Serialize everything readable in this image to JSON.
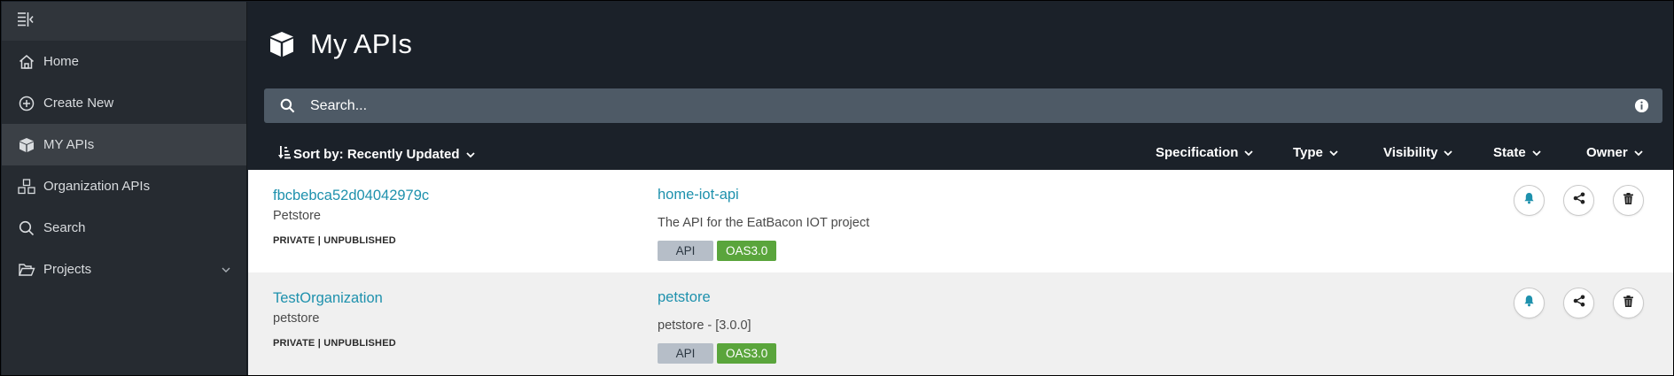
{
  "sidebar": {
    "items": [
      {
        "label": "Home",
        "icon": "home-icon"
      },
      {
        "label": "Create New",
        "icon": "plus-circle-icon"
      },
      {
        "label": "MY APIs",
        "icon": "cube-icon",
        "active": true
      },
      {
        "label": "Organization APIs",
        "icon": "cubes-icon"
      },
      {
        "label": "Search",
        "icon": "search-icon"
      },
      {
        "label": "Projects",
        "icon": "folder-open-icon",
        "expandable": true
      }
    ]
  },
  "header": {
    "title": "My APIs",
    "icon": "cube-icon"
  },
  "search": {
    "placeholder": "Search..."
  },
  "toolbar": {
    "sort_label": "Sort by: Recently Updated",
    "filters": [
      "Specification",
      "Type",
      "Visibility",
      "State",
      "Owner"
    ]
  },
  "apis": [
    {
      "owner": "fbcbebca52d04042979c",
      "group": "Petstore",
      "visibility": "PRIVATE | UNPUBLISHED",
      "name": "home-iot-api",
      "description": "The API for the EatBacon IOT project",
      "type": "API",
      "spec": "OAS3.0"
    },
    {
      "owner": "TestOrganization",
      "group": "petstore",
      "visibility": "PRIVATE | UNPUBLISHED",
      "name": "petstore",
      "description": "petstore - [3.0.0]",
      "type": "API",
      "spec": "OAS3.0"
    }
  ],
  "colors": {
    "sidebar_bg": "#262b31",
    "main_bg": "#1b2129",
    "link": "#1e91ad",
    "spec_tag": "#5aa53c",
    "type_tag": "#b6bec8"
  }
}
